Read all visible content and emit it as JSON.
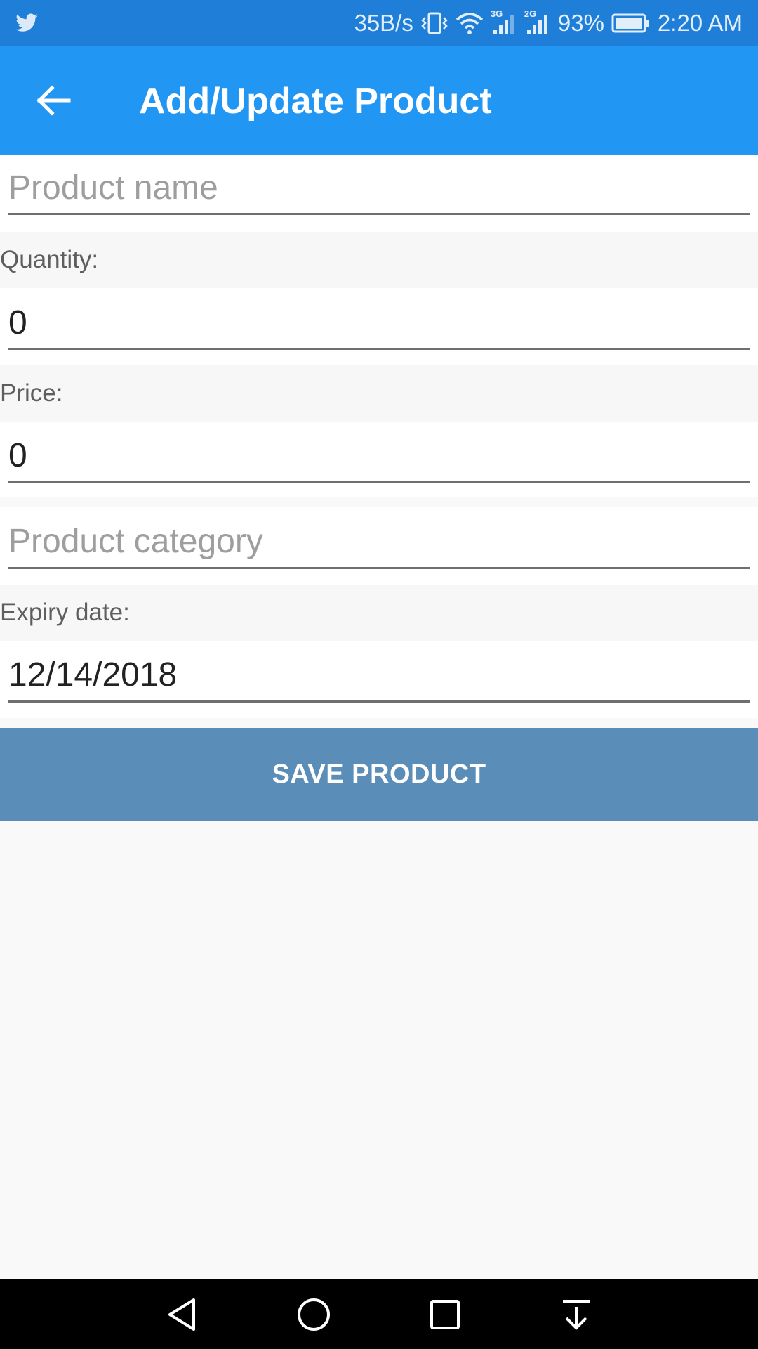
{
  "status_bar": {
    "network_speed": "35B/s",
    "network_3g": "3G",
    "network_2g": "2G",
    "battery": "93%",
    "time": "2:20 AM",
    "icons": [
      "twitter-icon",
      "vibrate-icon",
      "wifi-icon",
      "signal-icon",
      "signal-icon",
      "battery-icon"
    ]
  },
  "app_bar": {
    "title": "Add/Update Product",
    "back_icon": "arrow-back-icon"
  },
  "form": {
    "product_name": {
      "placeholder": "Product name",
      "value": ""
    },
    "quantity": {
      "label": "Quantity:",
      "value": "0"
    },
    "price": {
      "label": "Price:",
      "value": "0"
    },
    "product_category": {
      "placeholder": "Product category",
      "value": ""
    },
    "expiry_date": {
      "label": "Expiry date:",
      "value": "12/14/2018"
    }
  },
  "save_button": {
    "label": "SAVE PRODUCT"
  },
  "nav_bar": {
    "icons": [
      "nav-back-icon",
      "nav-home-icon",
      "nav-recents-icon",
      "nav-notifications-icon"
    ]
  },
  "colors": {
    "status_bar": "#1f7fd8",
    "app_bar": "#2196f3",
    "save_button": "#5b8db9",
    "background": "#f9f9f9"
  }
}
